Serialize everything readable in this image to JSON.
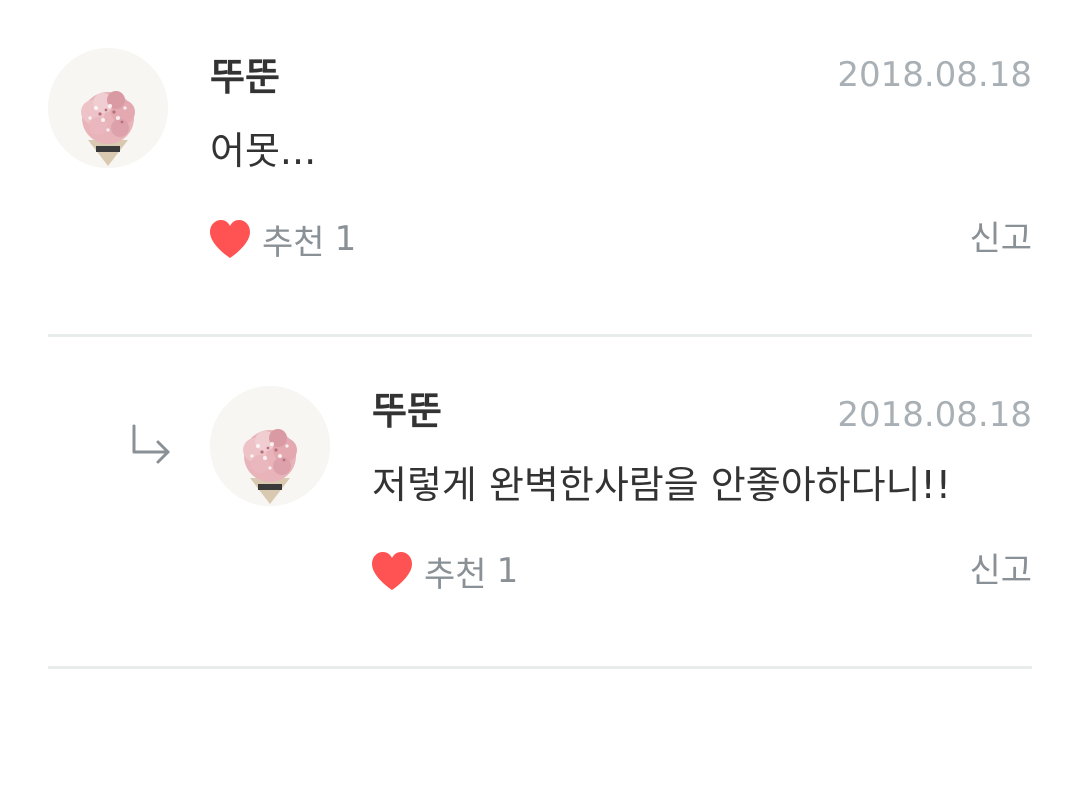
{
  "comments": [
    {
      "username": "뚜뚠",
      "date": "2018.08.18",
      "text": "어못...",
      "like_label": "추천",
      "like_count": "1",
      "report_label": "신고",
      "avatar_icon": "flower-bouquet-avatar",
      "is_reply": false
    },
    {
      "username": "뚜뚠",
      "date": "2018.08.18",
      "text": "저렇게 완벽한사람을 안좋아하다니!!",
      "like_label": "추천",
      "like_count": "1",
      "report_label": "신고",
      "avatar_icon": "flower-bouquet-avatar",
      "is_reply": true,
      "reply_icon": "reply-arrow-icon"
    }
  ],
  "colors": {
    "heart": "#ff5252",
    "muted_text": "#8a9196",
    "date_text": "#a9b0b5",
    "divider": "#e8edeb"
  }
}
